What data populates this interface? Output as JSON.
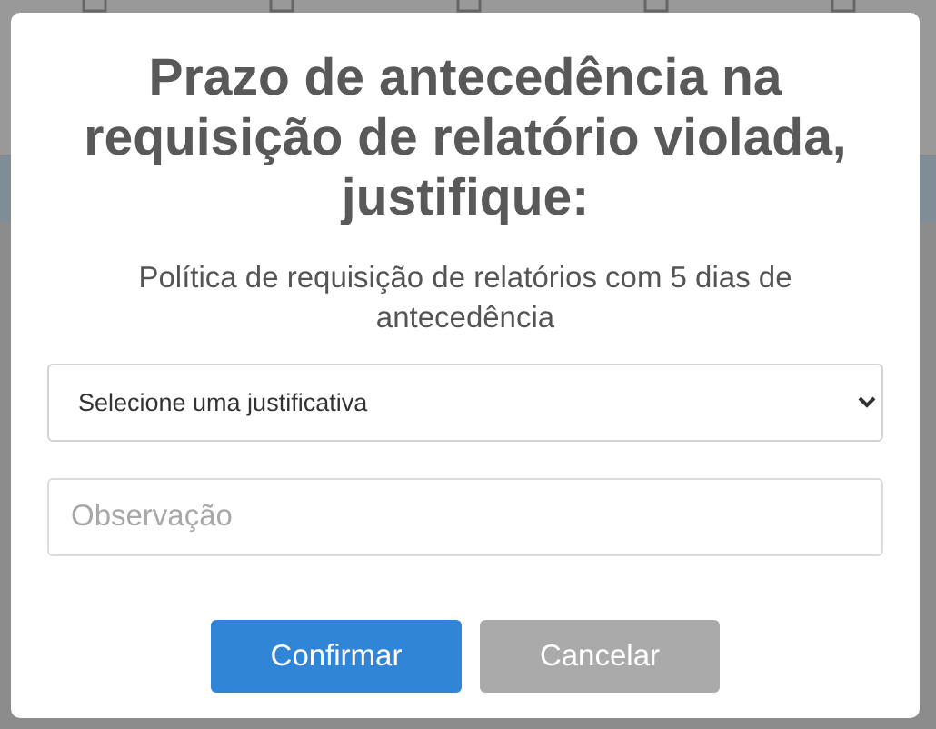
{
  "dialog": {
    "title": "Prazo de antecedência na requisição de relatório violada, justifique:",
    "subtitle": "Política de requisição de relatórios com 5 dias de antecedência",
    "justification_select": {
      "value": "Selecione uma justificativa"
    },
    "observation_field": {
      "placeholder": "Observação"
    },
    "buttons": [
      {
        "label": "Confirmar",
        "kind": "primary"
      },
      {
        "label": "Cancelar",
        "kind": "secondary"
      }
    ]
  }
}
